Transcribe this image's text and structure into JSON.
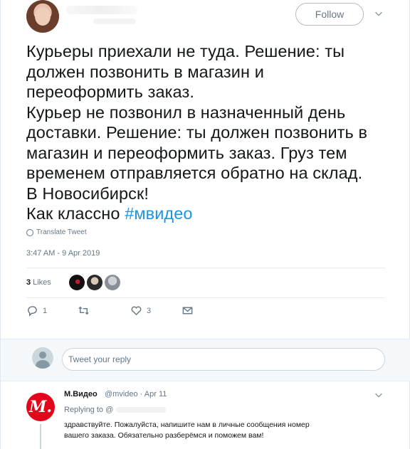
{
  "header": {
    "follow_label": "Follow"
  },
  "tweet": {
    "lines": [
      "Курьеры приехали не туда. Решение: ты",
      "должен позвонить в магазин и",
      "переоформить заказ.",
      "Курьер не позвонил в назначенный день",
      "доставки. Решение: ты должен позвонить в",
      "магазин и переоформить заказ. Груз тем",
      "временем отправляется обратно на склад.",
      "В Новосибирск!",
      "Как классно "
    ],
    "hashtag": "#мвидео",
    "translate_label": "Translate Tweet",
    "timestamp": "3:47 AM - 9 Apr 2019",
    "likes_count": "3",
    "likes_label": "Likes"
  },
  "actions": {
    "reply_count": "1",
    "retweet_count": "",
    "like_count": "3"
  },
  "reply_box": {
    "placeholder": "Tweet your reply"
  },
  "reply_tweet": {
    "logo_text": "М.",
    "name": "М.Видео",
    "handle_date": "@mvideo · Apr 11",
    "replying_to": "Replying to @",
    "text_line1": "здравствуйте. Пожалуйста, напишите нам в личные сообщения номер",
    "text_line2": "вашего заказа. Обязательно разберёмся и поможем вам!"
  },
  "colors": {
    "link": "#1b95e0",
    "muted": "#657786",
    "mvideo_red": "#e3051b"
  }
}
